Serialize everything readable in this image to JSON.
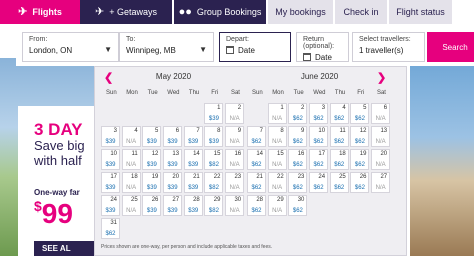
{
  "nav": {
    "tabs": [
      {
        "label": "Flights",
        "icon": "plane-icon"
      },
      {
        "label": "+ Getaways",
        "icon": "plane-bed-icon"
      },
      {
        "label": "Group Bookings",
        "icon": "group-icon"
      },
      {
        "label": "My bookings"
      },
      {
        "label": "Check in"
      },
      {
        "label": "Flight status"
      }
    ]
  },
  "search": {
    "from_label": "From:",
    "from_value": "London, ON",
    "to_label": "To:",
    "to_value": "Winnipeg, MB",
    "depart_label": "Depart:",
    "depart_value": "Date",
    "return_label": "Return (optional):",
    "return_value": "Date",
    "travellers_label": "Select travellers:",
    "travellers_value": "1 traveller(s)",
    "button": "Search"
  },
  "promo": {
    "title": "3 DAY",
    "line1": "Save big",
    "line2": "with half",
    "fare_label": "One-way far",
    "currency": "$",
    "price": "99",
    "see_all": "SEE AL"
  },
  "calendar": {
    "dow": [
      "Sun",
      "Mon",
      "Tue",
      "Wed",
      "Thu",
      "Fri",
      "Sat"
    ],
    "months": [
      {
        "title": "May 2020",
        "lead_blank": 5,
        "days": [
          {
            "d": "1",
            "p": "$39"
          },
          {
            "d": "2",
            "p": "N/A"
          },
          {
            "d": "3",
            "p": "$39"
          },
          {
            "d": "4",
            "p": "N/A"
          },
          {
            "d": "5",
            "p": "$39"
          },
          {
            "d": "6",
            "p": "$39"
          },
          {
            "d": "7",
            "p": "$39"
          },
          {
            "d": "8",
            "p": "$39"
          },
          {
            "d": "9",
            "p": "N/A"
          },
          {
            "d": "10",
            "p": "$39"
          },
          {
            "d": "11",
            "p": "N/A"
          },
          {
            "d": "12",
            "p": "$39"
          },
          {
            "d": "13",
            "p": "$39"
          },
          {
            "d": "14",
            "p": "$39"
          },
          {
            "d": "15",
            "p": "$82"
          },
          {
            "d": "16",
            "p": "N/A"
          },
          {
            "d": "17",
            "p": "$39"
          },
          {
            "d": "18",
            "p": "N/A"
          },
          {
            "d": "19",
            "p": "$39"
          },
          {
            "d": "20",
            "p": "$39"
          },
          {
            "d": "21",
            "p": "$39"
          },
          {
            "d": "22",
            "p": "$82"
          },
          {
            "d": "23",
            "p": "N/A"
          },
          {
            "d": "24",
            "p": "$39"
          },
          {
            "d": "25",
            "p": "N/A"
          },
          {
            "d": "26",
            "p": "$39"
          },
          {
            "d": "27",
            "p": "$39"
          },
          {
            "d": "28",
            "p": "$39"
          },
          {
            "d": "29",
            "p": "$82"
          },
          {
            "d": "30",
            "p": "N/A"
          },
          {
            "d": "31",
            "p": "$62"
          }
        ]
      },
      {
        "title": "June 2020",
        "lead_blank": 1,
        "days": [
          {
            "d": "1",
            "p": "N/A"
          },
          {
            "d": "2",
            "p": "$62"
          },
          {
            "d": "3",
            "p": "$62"
          },
          {
            "d": "4",
            "p": "$62"
          },
          {
            "d": "5",
            "p": "$62"
          },
          {
            "d": "6",
            "p": "N/A"
          },
          {
            "d": "7",
            "p": "$62"
          },
          {
            "d": "8",
            "p": "N/A"
          },
          {
            "d": "9",
            "p": "$62"
          },
          {
            "d": "10",
            "p": "$62"
          },
          {
            "d": "11",
            "p": "$62"
          },
          {
            "d": "12",
            "p": "$62"
          },
          {
            "d": "13",
            "p": "N/A"
          },
          {
            "d": "14",
            "p": "$62"
          },
          {
            "d": "15",
            "p": "N/A"
          },
          {
            "d": "16",
            "p": "$62"
          },
          {
            "d": "17",
            "p": "$62"
          },
          {
            "d": "18",
            "p": "$62"
          },
          {
            "d": "19",
            "p": "$62"
          },
          {
            "d": "20",
            "p": "N/A"
          },
          {
            "d": "21",
            "p": "$62"
          },
          {
            "d": "22",
            "p": "N/A"
          },
          {
            "d": "23",
            "p": "$62"
          },
          {
            "d": "24",
            "p": "$62"
          },
          {
            "d": "25",
            "p": "$62"
          },
          {
            "d": "26",
            "p": "$62"
          },
          {
            "d": "27",
            "p": "N/A"
          },
          {
            "d": "28",
            "p": "$62"
          },
          {
            "d": "29",
            "p": "N/A"
          },
          {
            "d": "30",
            "p": "$62"
          }
        ]
      }
    ],
    "footnote": "Prices shown are one-way, per person and include applicable taxes and fees."
  },
  "colors": {
    "brand_pink": "#e6007e",
    "brand_navy": "#2b2250",
    "price_blue": "#1a6fb0"
  }
}
